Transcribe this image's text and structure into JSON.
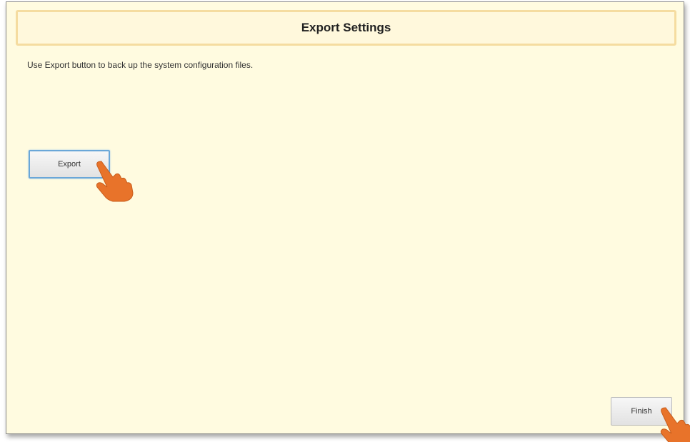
{
  "dialog": {
    "title": "Export Settings",
    "description": "Use Export button to back up the system configuration files."
  },
  "buttons": {
    "export_label": "Export",
    "finish_label": "Finish"
  },
  "icons": {
    "pointer": "hand-pointer-icon"
  },
  "colors": {
    "panel_background": "#fffbe0",
    "title_border": "#f5dca0",
    "export_focus_border": "#6aa7d8",
    "pointer_color": "#e8732a"
  }
}
